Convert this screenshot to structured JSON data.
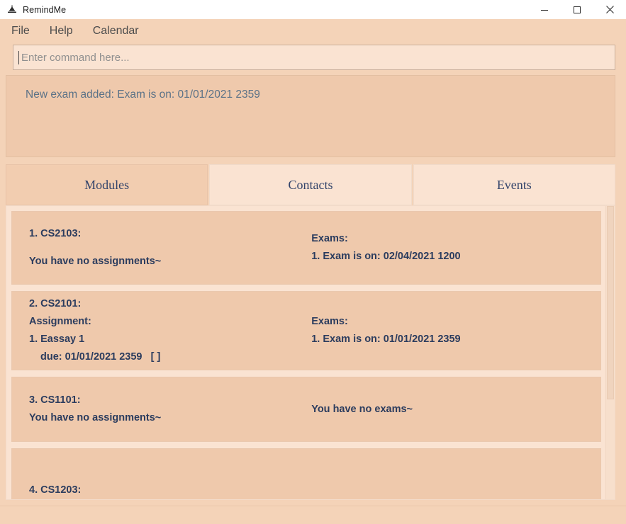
{
  "window": {
    "title": "RemindMe",
    "icon": "app-icon",
    "controls": {
      "minimize": "minimize-icon",
      "maximize": "maximize-icon",
      "close": "close-icon"
    }
  },
  "menubar": {
    "items": [
      {
        "label": "File"
      },
      {
        "label": "Help"
      },
      {
        "label": "Calendar"
      }
    ]
  },
  "command": {
    "placeholder": "Enter command here...",
    "value": ""
  },
  "result": {
    "text": "New exam added: Exam is on: 01/01/2021 2359"
  },
  "tabs": [
    {
      "label": "Modules",
      "selected": true
    },
    {
      "label": "Contacts",
      "selected": false
    },
    {
      "label": "Events",
      "selected": false
    }
  ],
  "modules": [
    {
      "title": "1. CS2103:",
      "assignments_heading": "",
      "assignments_empty": "You have no assignments~",
      "assignment_items": [],
      "exams_heading": "Exams:",
      "exams_empty": "",
      "exam_items": [
        "1. Exam is on: 02/04/2021 1200"
      ]
    },
    {
      "title": "2. CS2101:",
      "assignments_heading": "Assignment:",
      "assignments_empty": "",
      "assignment_items": [
        {
          "name": "1. Eassay 1",
          "due": "due: 01/01/2021 2359",
          "status": "[ ]"
        }
      ],
      "exams_heading": "Exams:",
      "exams_empty": "",
      "exam_items": [
        "1. Exam is on: 01/01/2021 2359"
      ]
    },
    {
      "title": "3. CS1101:",
      "assignments_heading": "",
      "assignments_empty": "You have no assignments~",
      "assignment_items": [],
      "exams_heading": "",
      "exams_empty": "You have no exams~",
      "exam_items": []
    },
    {
      "title": "4. CS1203:",
      "assignments_heading": "",
      "assignments_empty": "",
      "assignment_items": [],
      "exams_heading": "",
      "exams_empty": "",
      "exam_items": []
    }
  ],
  "colors": {
    "window_chrome": "#f4d3b8",
    "card_background": "#efc9ac",
    "panel_background": "#fae3d2",
    "tab_selected": "#f2cdb0",
    "text_primary": "#2b3c5e",
    "text_result": "#5b7287",
    "text_menu": "#4d4d4d"
  }
}
